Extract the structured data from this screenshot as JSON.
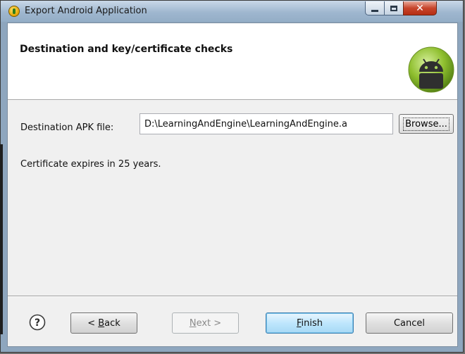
{
  "window": {
    "title": "Export Android Application",
    "controls": {
      "minimize": "minimize",
      "maximize": "maximize",
      "close": "✕"
    }
  },
  "header": {
    "title": "Destination and key/certificate checks",
    "logo_icon": "android-robot-icon"
  },
  "form": {
    "destination_label": "Destination APK file:",
    "destination_value": "D:\\LearningAndEngine\\LearningAndEngine.a",
    "browse_label": "Browse...",
    "certificate_text": "Certificate expires in 25 years."
  },
  "footer": {
    "help_icon": "help-icon",
    "back_label_prefix": "< ",
    "back_label_mnemonic": "B",
    "back_label_rest": "ack",
    "next_label_mnemonic": "N",
    "next_label_rest": "ext >",
    "finish_label_mnemonic": "F",
    "finish_label_rest": "inish",
    "cancel_label": "Cancel"
  },
  "colors": {
    "titlebar": "#9fb7cf",
    "client_bg": "#f0f0f0",
    "header_bg": "#ffffff",
    "close_button": "#c7452b",
    "default_button": "#bee6fd"
  }
}
